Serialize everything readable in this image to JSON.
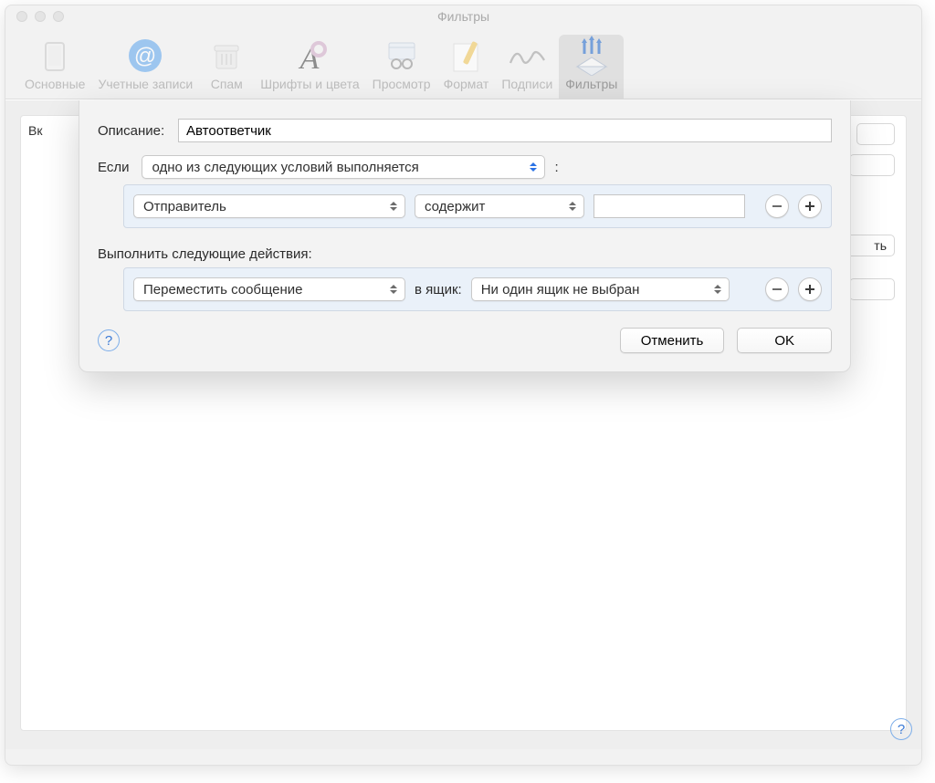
{
  "window": {
    "title": "Фильтры"
  },
  "toolbar": {
    "items": [
      {
        "label": "Основные"
      },
      {
        "label": "Учетные записи"
      },
      {
        "label": "Спам"
      },
      {
        "label": "Шрифты и цвета"
      },
      {
        "label": "Просмотр"
      },
      {
        "label": "Формат"
      },
      {
        "label": "Подписи"
      },
      {
        "label": "Фильтры"
      }
    ]
  },
  "back": {
    "colLabel": "Вк"
  },
  "sheet": {
    "descLabel": "Описание:",
    "descValue": "Автоответчик",
    "ifLabel": "Если",
    "ifPopup": "одно из следующих условий выполняется",
    "colon": ":",
    "cond": {
      "field": "Отправитель",
      "op": "содержит",
      "value": ""
    },
    "actionsLabel": "Выполнить следующие действия:",
    "action": {
      "verb": "Переместить сообщение",
      "boxLabel": "в ящик:",
      "target": "Ни один ящик не выбран"
    },
    "cancel": "Отменить",
    "ok": "OK"
  },
  "partialButton": "ть"
}
